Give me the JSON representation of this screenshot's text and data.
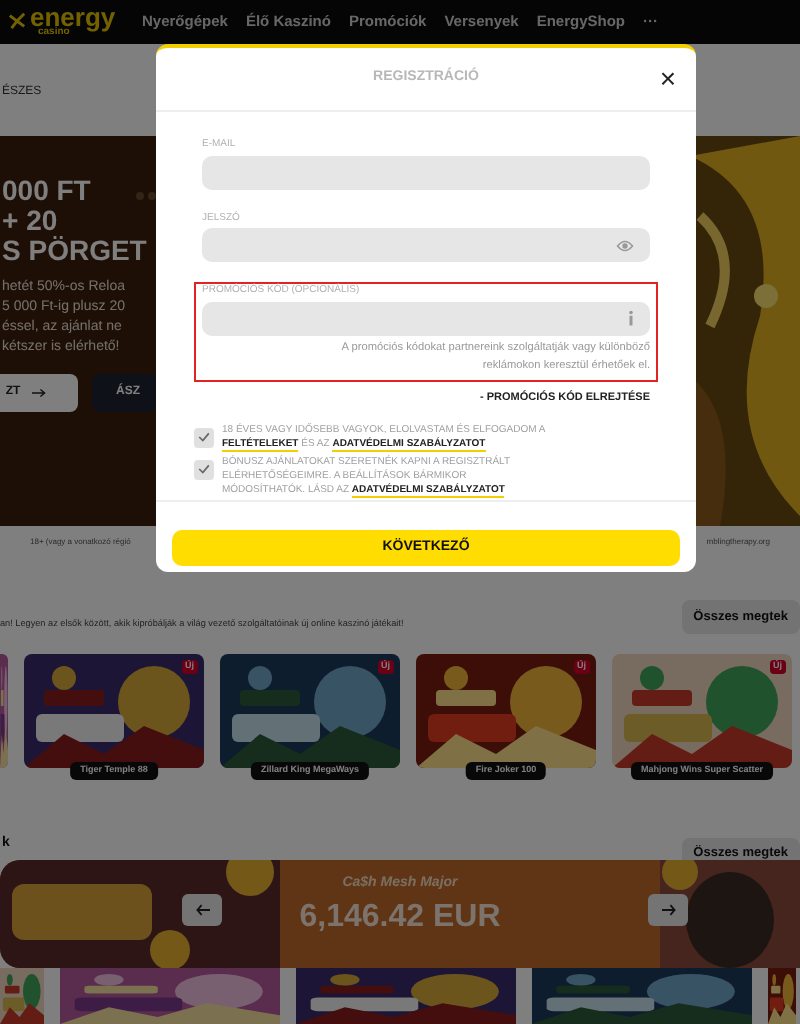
{
  "header": {
    "logo": {
      "word": "energy",
      "sub": "casino"
    },
    "nav": [
      "Nyerőgépek",
      "Élő Kaszinó",
      "Promóciók",
      "Versenyek",
      "EnergyShop",
      "···"
    ]
  },
  "breadcrumb": "ÉSZES",
  "hero": {
    "title_lines": [
      "000 FT",
      "+ 20",
      "S PÖRGET"
    ],
    "text_lines": [
      "hetét 50%-os Reloa",
      "5 000 Ft-ig plusz 20",
      "éssel, az ajánlat ne",
      "kétszer is elérhető!"
    ],
    "buttons": [
      {
        "label": "ZT",
        "kind": "light"
      },
      {
        "label": "ÁSZ",
        "kind": "dark"
      }
    ],
    "disclaimer_left": "18+ (vagy a vonatkozó régió",
    "disclaimer_right": "mblingtherapy.org"
  },
  "new_games": {
    "subtitle": "an! Legyen az elsők között, akik kipróbálják a világ vezető szolgáltatóinak új online kaszinó játékait!",
    "all_button": "Összes megtek",
    "games": [
      {
        "name": "Tiger Temple 88",
        "badge": "Új"
      },
      {
        "name": "Zillard King MegaWays",
        "badge": "Új"
      },
      {
        "name": "Fire Joker 100",
        "badge": "Új"
      },
      {
        "name": "Mahjong Wins Super Scatter",
        "badge": "Új"
      }
    ]
  },
  "jackpots": {
    "heading": "k",
    "all_button": "Összes megtek",
    "banner": {
      "title": "Ca$h Mesh Major",
      "amount": "6,146.42 EUR"
    }
  },
  "modal": {
    "title": "REGISZTRÁCIÓ",
    "close": "×",
    "fields": [
      {
        "label": "E-MAIL",
        "kind": "plain",
        "highlighted": false
      },
      {
        "label": "JELSZÓ",
        "kind": "password",
        "highlighted": false
      },
      {
        "label": "PROMÓCIÓS KÓD (OPCIONÁLIS)",
        "kind": "info",
        "highlighted": true,
        "help": "A promóciós kódokat partnereink szolgáltatják vagy különböző reklámokon keresztül érhetőek el."
      }
    ],
    "hide_promo": "- PROMÓCIÓS KÓD ELREJTÉSE",
    "consents": [
      {
        "checked": true,
        "parts": [
          {
            "text": "18 ÉVES VAGY IDŐSEBB VAGYOK, ELOLVASTAM ÉS ELFOGADOM A ",
            "kind": "text"
          },
          {
            "text": "FELTÉTELEKET",
            "kind": "link"
          },
          {
            "text": " ÉS AZ ",
            "kind": "text"
          },
          {
            "text": "ADATVÉDELMI SZABÁLYZATOT",
            "kind": "link"
          }
        ]
      },
      {
        "checked": true,
        "parts": [
          {
            "text": "BÓNUSZ AJÁNLATOKAT SZERETNÉK KAPNI A REGISZTRÁLT ELÉRHETŐSÉGEIMRE. A BEÁLLÍTÁSOK BÁRMIKOR MÓDOSÍTHATÓK. LÁSD AZ ",
            "kind": "text"
          },
          {
            "text": "ADATVÉDELMI SZABÁLYZATOT",
            "kind": "link"
          }
        ]
      }
    ],
    "submit": "KÖVETKEZŐ"
  }
}
